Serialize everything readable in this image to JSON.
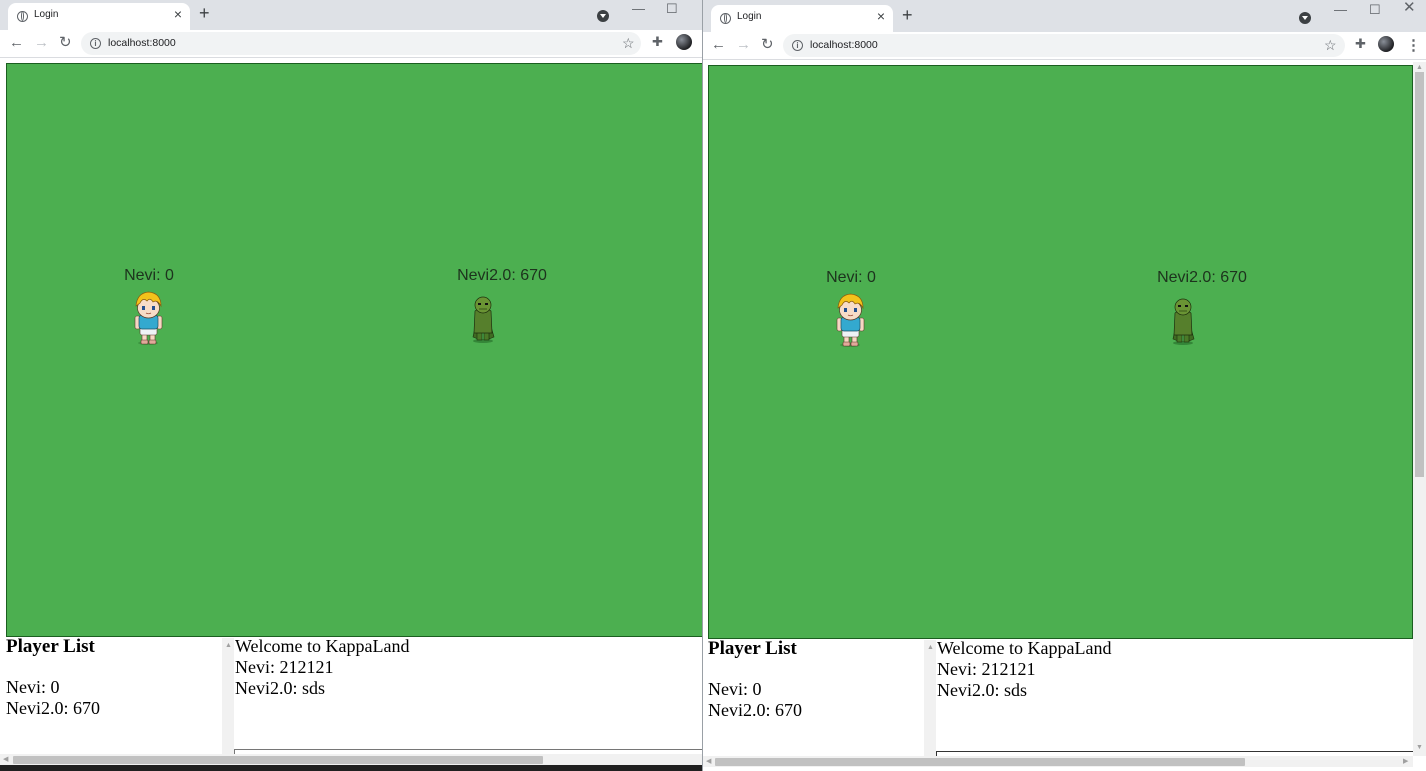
{
  "browser": {
    "tab_title": "Login",
    "url": "localhost:8000",
    "new_tab": "+",
    "close_tab": "×",
    "menu": "⋮"
  },
  "game": {
    "players": [
      {
        "label": "Nevi: 0",
        "sprite": "blonde-boy-sprite"
      },
      {
        "label": "Nevi2.0: 670",
        "sprite": "green-orc-sprite"
      }
    ],
    "background_color": "#4caf50"
  },
  "panel": {
    "player_list_title": "Player List",
    "player_list": [
      "Nevi: 0",
      "Nevi2.0: 670"
    ]
  },
  "chat": {
    "messages": [
      "Welcome to KappaLand",
      "Nevi: 212121",
      "Nevi2.0: sds"
    ]
  }
}
